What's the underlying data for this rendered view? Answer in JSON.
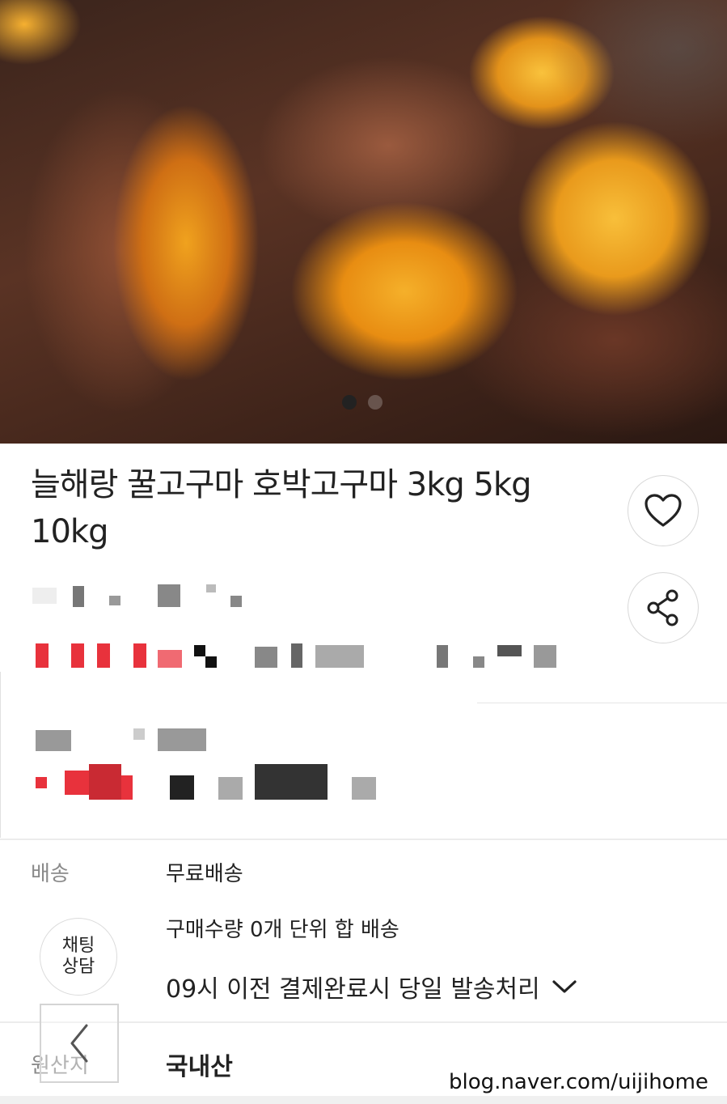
{
  "product": {
    "title": "늘해랑 꿀고구마 호박고구마 3kg 5kg 10kg"
  },
  "carousel": {
    "slide_count": 2,
    "active_index": 0
  },
  "shipping": {
    "label": "배송",
    "fee": "무료배송",
    "bundle_note": "구매수량 0개 단위 합 배송",
    "dispatch_note": "09시 이전 결제완료시 당일 발송처리"
  },
  "origin": {
    "label": "원산지",
    "value": "국내산"
  },
  "chat_button": {
    "line1": "채팅",
    "line2": "상담"
  },
  "watermark": "blog.naver.com/uijihome",
  "colors": {
    "accent_red": "#e8323c",
    "text": "#222222",
    "muted": "#8a8a8a"
  },
  "icons": [
    "heart-icon",
    "share-icon",
    "chevron-down-icon",
    "chevron-left-icon"
  ]
}
